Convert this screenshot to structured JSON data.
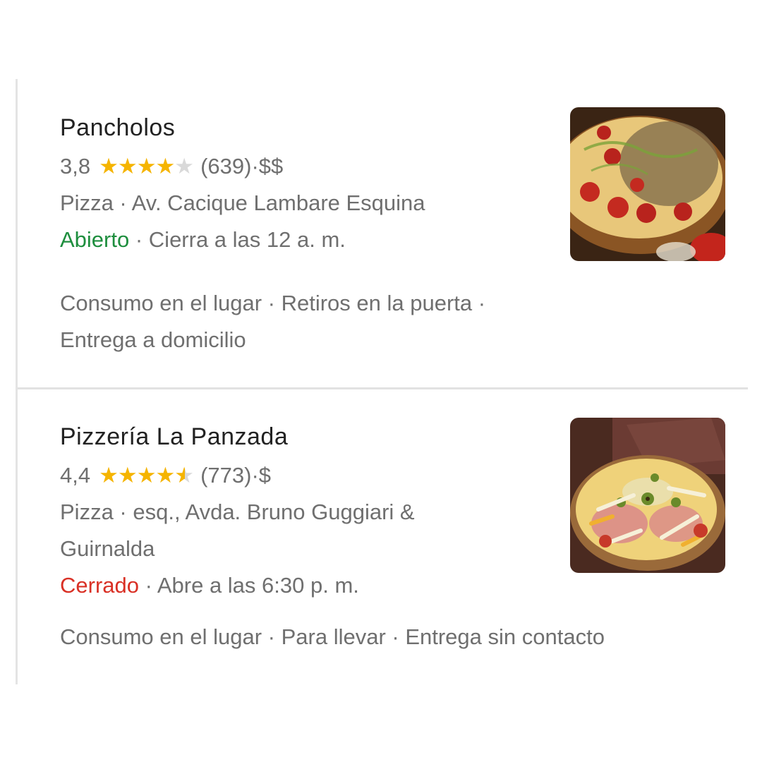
{
  "results": [
    {
      "name": "Pancholos",
      "rating": "3,8",
      "stars": 3.8,
      "reviews": "(639)",
      "price": "$$",
      "category_address": "Pizza · Av. Cacique Lambare Esquina",
      "address_line2": "",
      "status": "Abierto",
      "status_color": "#1e8e3e",
      "hours": "Cierra a las 12 a. m.",
      "services_line1": "Consumo en el lugar · Retiros en la puerta ·",
      "services_line2": "Entrega a domicilio",
      "thumbnail_icon": "pizza-photo"
    },
    {
      "name": "Pizzería La Panzada",
      "rating": "4,4",
      "stars": 4.4,
      "reviews": "(773)",
      "price": "$",
      "category_address": "Pizza · esq., Avda. Bruno Guggiari &",
      "address_line2": "Guirnalda",
      "status": "Cerrado",
      "status_color": "#d93025",
      "hours": "Abre a las 6:30 p. m.",
      "services_line1": "Consumo en el lugar · Para llevar · Entrega sin contacto",
      "services_line2": "",
      "thumbnail_icon": "pizza-photo"
    }
  ],
  "separator_dot": " · ",
  "star_color": "#f5b400",
  "star_empty_color": "#d9d9d9"
}
